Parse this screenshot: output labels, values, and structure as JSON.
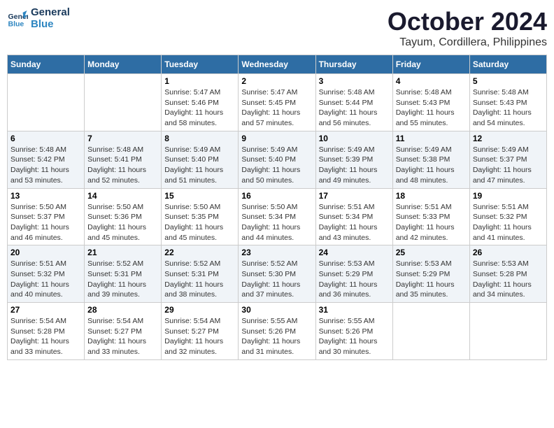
{
  "logo": {
    "line1": "General",
    "line2": "Blue"
  },
  "title": "October 2024",
  "location": "Tayum, Cordillera, Philippines",
  "weekdays": [
    "Sunday",
    "Monday",
    "Tuesday",
    "Wednesday",
    "Thursday",
    "Friday",
    "Saturday"
  ],
  "weeks": [
    [
      {
        "day": "",
        "info": ""
      },
      {
        "day": "",
        "info": ""
      },
      {
        "day": "1",
        "info": "Sunrise: 5:47 AM\nSunset: 5:46 PM\nDaylight: 11 hours\nand 58 minutes."
      },
      {
        "day": "2",
        "info": "Sunrise: 5:47 AM\nSunset: 5:45 PM\nDaylight: 11 hours\nand 57 minutes."
      },
      {
        "day": "3",
        "info": "Sunrise: 5:48 AM\nSunset: 5:44 PM\nDaylight: 11 hours\nand 56 minutes."
      },
      {
        "day": "4",
        "info": "Sunrise: 5:48 AM\nSunset: 5:43 PM\nDaylight: 11 hours\nand 55 minutes."
      },
      {
        "day": "5",
        "info": "Sunrise: 5:48 AM\nSunset: 5:43 PM\nDaylight: 11 hours\nand 54 minutes."
      }
    ],
    [
      {
        "day": "6",
        "info": "Sunrise: 5:48 AM\nSunset: 5:42 PM\nDaylight: 11 hours\nand 53 minutes."
      },
      {
        "day": "7",
        "info": "Sunrise: 5:48 AM\nSunset: 5:41 PM\nDaylight: 11 hours\nand 52 minutes."
      },
      {
        "day": "8",
        "info": "Sunrise: 5:49 AM\nSunset: 5:40 PM\nDaylight: 11 hours\nand 51 minutes."
      },
      {
        "day": "9",
        "info": "Sunrise: 5:49 AM\nSunset: 5:40 PM\nDaylight: 11 hours\nand 50 minutes."
      },
      {
        "day": "10",
        "info": "Sunrise: 5:49 AM\nSunset: 5:39 PM\nDaylight: 11 hours\nand 49 minutes."
      },
      {
        "day": "11",
        "info": "Sunrise: 5:49 AM\nSunset: 5:38 PM\nDaylight: 11 hours\nand 48 minutes."
      },
      {
        "day": "12",
        "info": "Sunrise: 5:49 AM\nSunset: 5:37 PM\nDaylight: 11 hours\nand 47 minutes."
      }
    ],
    [
      {
        "day": "13",
        "info": "Sunrise: 5:50 AM\nSunset: 5:37 PM\nDaylight: 11 hours\nand 46 minutes."
      },
      {
        "day": "14",
        "info": "Sunrise: 5:50 AM\nSunset: 5:36 PM\nDaylight: 11 hours\nand 45 minutes."
      },
      {
        "day": "15",
        "info": "Sunrise: 5:50 AM\nSunset: 5:35 PM\nDaylight: 11 hours\nand 45 minutes."
      },
      {
        "day": "16",
        "info": "Sunrise: 5:50 AM\nSunset: 5:34 PM\nDaylight: 11 hours\nand 44 minutes."
      },
      {
        "day": "17",
        "info": "Sunrise: 5:51 AM\nSunset: 5:34 PM\nDaylight: 11 hours\nand 43 minutes."
      },
      {
        "day": "18",
        "info": "Sunrise: 5:51 AM\nSunset: 5:33 PM\nDaylight: 11 hours\nand 42 minutes."
      },
      {
        "day": "19",
        "info": "Sunrise: 5:51 AM\nSunset: 5:32 PM\nDaylight: 11 hours\nand 41 minutes."
      }
    ],
    [
      {
        "day": "20",
        "info": "Sunrise: 5:51 AM\nSunset: 5:32 PM\nDaylight: 11 hours\nand 40 minutes."
      },
      {
        "day": "21",
        "info": "Sunrise: 5:52 AM\nSunset: 5:31 PM\nDaylight: 11 hours\nand 39 minutes."
      },
      {
        "day": "22",
        "info": "Sunrise: 5:52 AM\nSunset: 5:31 PM\nDaylight: 11 hours\nand 38 minutes."
      },
      {
        "day": "23",
        "info": "Sunrise: 5:52 AM\nSunset: 5:30 PM\nDaylight: 11 hours\nand 37 minutes."
      },
      {
        "day": "24",
        "info": "Sunrise: 5:53 AM\nSunset: 5:29 PM\nDaylight: 11 hours\nand 36 minutes."
      },
      {
        "day": "25",
        "info": "Sunrise: 5:53 AM\nSunset: 5:29 PM\nDaylight: 11 hours\nand 35 minutes."
      },
      {
        "day": "26",
        "info": "Sunrise: 5:53 AM\nSunset: 5:28 PM\nDaylight: 11 hours\nand 34 minutes."
      }
    ],
    [
      {
        "day": "27",
        "info": "Sunrise: 5:54 AM\nSunset: 5:28 PM\nDaylight: 11 hours\nand 33 minutes."
      },
      {
        "day": "28",
        "info": "Sunrise: 5:54 AM\nSunset: 5:27 PM\nDaylight: 11 hours\nand 33 minutes."
      },
      {
        "day": "29",
        "info": "Sunrise: 5:54 AM\nSunset: 5:27 PM\nDaylight: 11 hours\nand 32 minutes."
      },
      {
        "day": "30",
        "info": "Sunrise: 5:55 AM\nSunset: 5:26 PM\nDaylight: 11 hours\nand 31 minutes."
      },
      {
        "day": "31",
        "info": "Sunrise: 5:55 AM\nSunset: 5:26 PM\nDaylight: 11 hours\nand 30 minutes."
      },
      {
        "day": "",
        "info": ""
      },
      {
        "day": "",
        "info": ""
      }
    ]
  ]
}
